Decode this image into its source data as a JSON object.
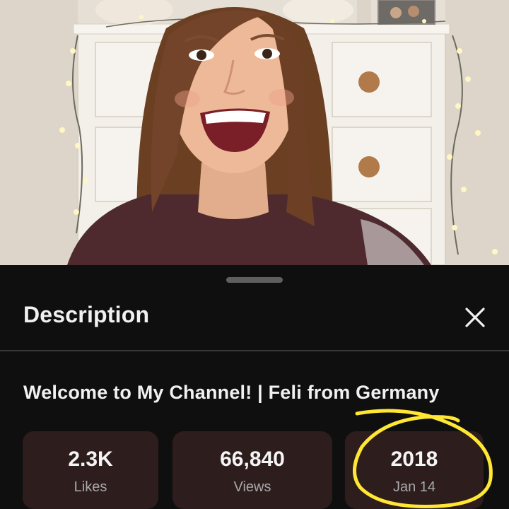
{
  "sheet": {
    "title": "Description",
    "close_icon": "close-icon"
  },
  "video": {
    "title": "Welcome to My Channel! | Feli from Germany"
  },
  "stats": {
    "likes": {
      "value": "2.3K",
      "label": "Likes"
    },
    "views": {
      "value": "66,840",
      "label": "Views"
    },
    "date": {
      "value": "2018",
      "label": "Jan 14"
    }
  },
  "colors": {
    "background": "#0f0f0f",
    "stat_card": "#2e1d1d",
    "annotation": "#ffe733",
    "text_primary": "#f1f1f1",
    "text_secondary": "#a9a9a9"
  }
}
